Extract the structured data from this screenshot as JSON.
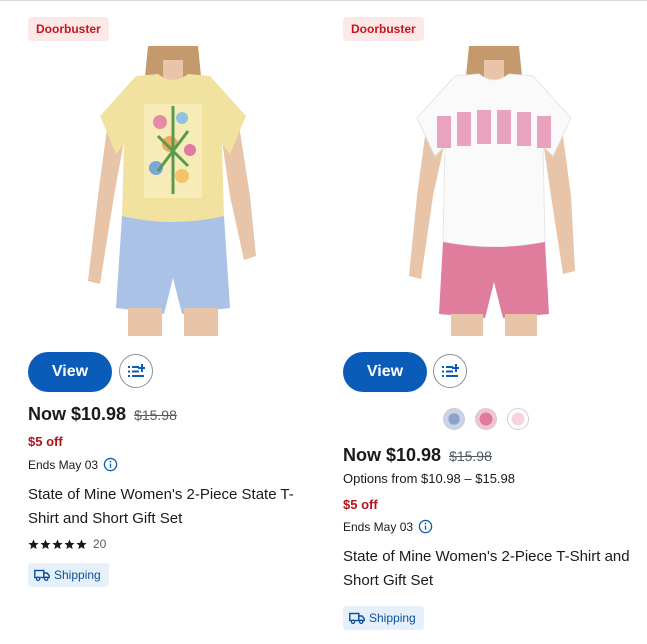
{
  "products": [
    {
      "badge": "Doorbuster",
      "image_alt": "Yellow floral T-shirt and light blue shorts",
      "view_label": "View",
      "now_price": "Now $10.98",
      "was_price": "$15.98",
      "savings": "$5 off",
      "ends": "Ends May 03",
      "title": "State of Mine Women's 2-Piece State T-Shirt and Short Gift Set",
      "rating": 5,
      "review_count": "20",
      "shipping": "Shipping",
      "shirt_color": "#f2e2a0",
      "shorts_color": "#a9c2e6"
    },
    {
      "badge": "Doorbuster",
      "image_alt": "White MAMA T-shirt and pink shorts",
      "view_label": "View",
      "now_price": "Now $10.98",
      "was_price": "$15.98",
      "options": "Options from $10.98 – $15.98",
      "savings": "$5 off",
      "ends": "Ends May 03",
      "title": "State of Mine Women's 2-Piece T-Shirt and Short Gift Set",
      "shipping": "Shipping",
      "swatch_count": 3,
      "shirt_color": "#fafafa",
      "shorts_color": "#e07c9c"
    }
  ],
  "colors": {
    "accent": "#0a5cb8",
    "badge_bg": "#fde8e8",
    "badge_text": "#c4161c",
    "savings": "#b3141b",
    "shipping_bg": "#e6f0fb"
  },
  "icons": [
    "add-to-list-icon",
    "info-icon",
    "star-icon",
    "truck-icon"
  ]
}
